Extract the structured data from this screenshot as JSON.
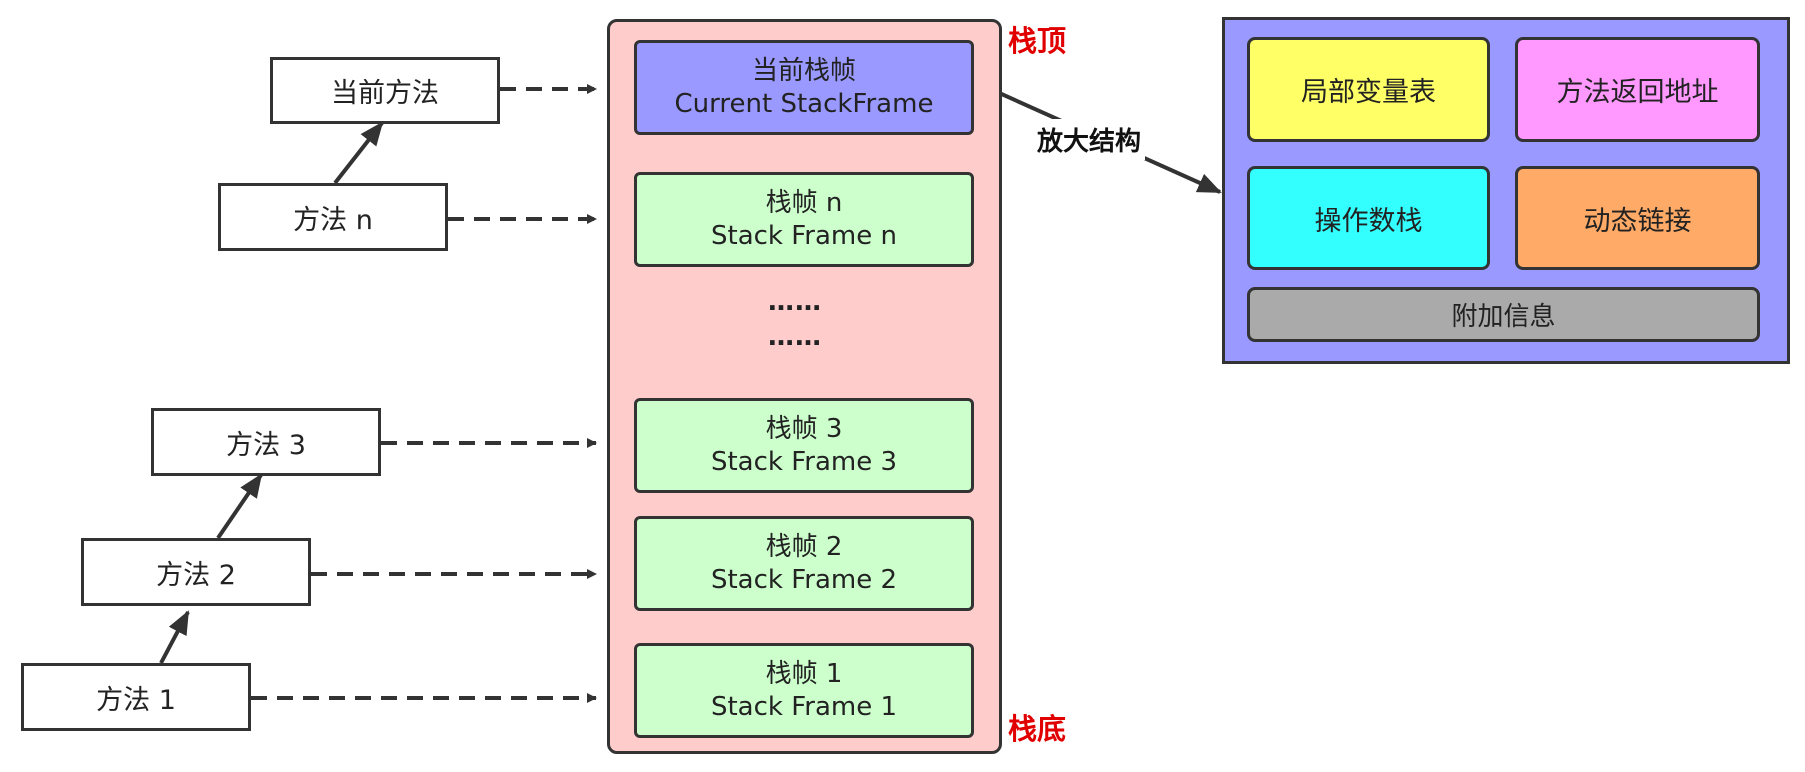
{
  "methods": {
    "current": "当前方法",
    "n": "方法 n",
    "m3": "方法 3",
    "m2": "方法 2",
    "m1": "方法 1"
  },
  "stack": {
    "top_label": "栈顶",
    "bottom_label": "栈底",
    "dots1": "……",
    "dots2": "……",
    "frames": {
      "current": {
        "line1": "当前栈帧",
        "line2": "Current StackFrame"
      },
      "n": {
        "line1": "栈帧 n",
        "line2": "Stack Frame n"
      },
      "f3": {
        "line1": "栈帧 3",
        "line2": "Stack Frame 3"
      },
      "f2": {
        "line1": "栈帧 2",
        "line2": "Stack Frame 2"
      },
      "f1": {
        "line1": "栈帧 1",
        "line2": "Stack Frame 1"
      }
    }
  },
  "zoom_label": "放大结构",
  "detail": {
    "local_vars": "局部变量表",
    "return_addr": "方法返回地址",
    "operand_stack": "操作数栈",
    "dynamic_link": "动态链接",
    "extra_info": "附加信息"
  },
  "colors": {
    "stack_bg": "#ffcccc",
    "frame_bg": "#ccffcc",
    "current_frame_bg": "#9999ff",
    "label_red": "#e00000",
    "detail_bg": "#9999ff",
    "local_vars": "#ffff66",
    "return_addr": "#ff99ff",
    "operand_stack": "#33ffff",
    "dynamic_link": "#ffaa66",
    "extra_info": "#aaaaaa"
  }
}
